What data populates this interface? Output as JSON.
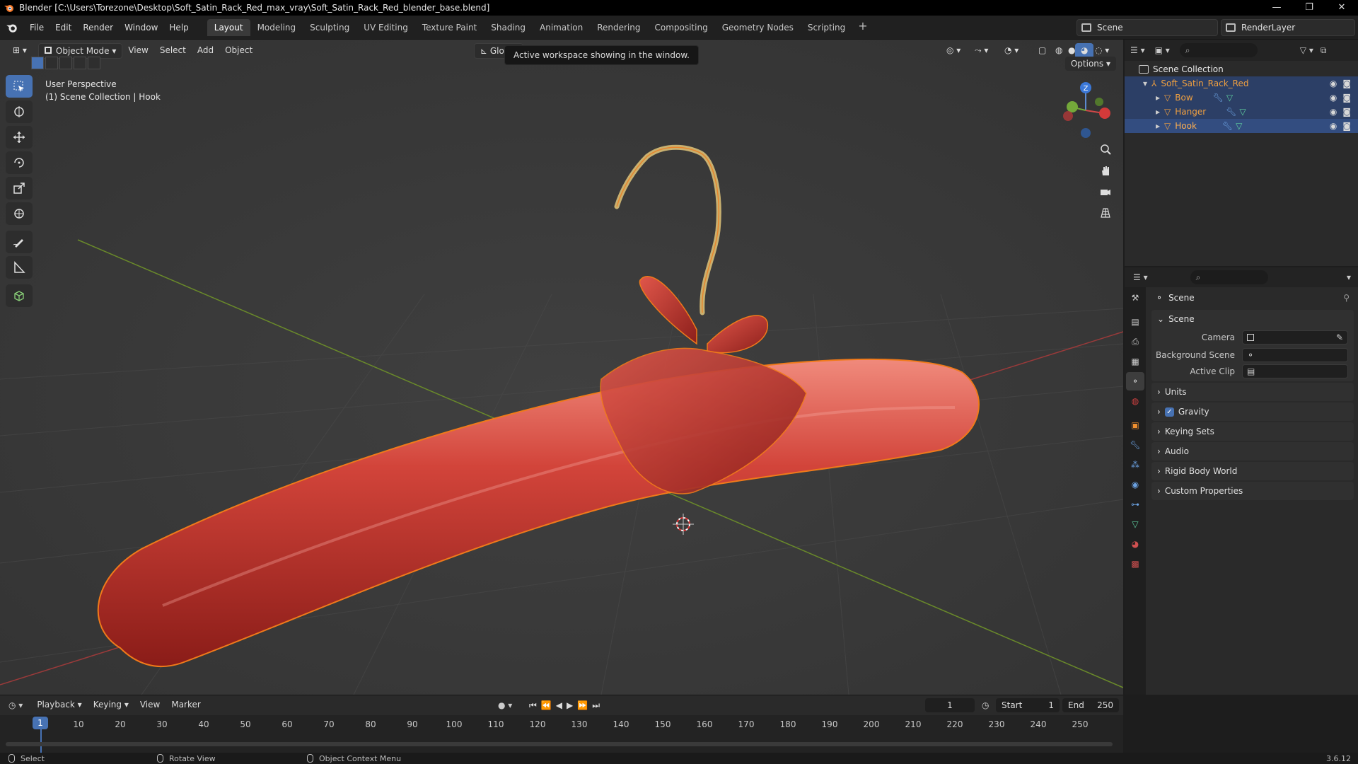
{
  "window": {
    "title": "Blender [C:\\Users\\Torezone\\Desktop\\Soft_Satin_Rack_Red_max_vray\\Soft_Satin_Rack_Red_blender_base.blend]",
    "controls": [
      "—",
      "❐",
      "✕"
    ]
  },
  "menubar": {
    "items": [
      "File",
      "Edit",
      "Render",
      "Window",
      "Help"
    ],
    "workspaces": [
      "Layout",
      "Modeling",
      "Sculpting",
      "UV Editing",
      "Texture Paint",
      "Shading",
      "Animation",
      "Rendering",
      "Compositing",
      "Geometry Nodes",
      "Scripting"
    ],
    "active_workspace": "Layout",
    "add_workspace": "+",
    "scene": "Scene",
    "view_layer": "RenderLayer"
  },
  "viewport": {
    "mode": "Object Mode",
    "menus": [
      "View",
      "Select",
      "Add",
      "Object"
    ],
    "orientation": "Global",
    "tooltip": "Active workspace showing in the window.",
    "options": "Options",
    "overlay_line1": "User Perspective",
    "overlay_line2": "(1) Scene Collection | Hook",
    "gizmo_z": "Z"
  },
  "outliner": {
    "root": "Scene Collection",
    "collection": "Soft_Satin_Rack_Red",
    "objects": [
      "Bow",
      "Hanger",
      "Hook"
    ]
  },
  "properties": {
    "context": "Scene",
    "panel": "Scene",
    "camera_label": "Camera",
    "background_label": "Background Scene",
    "clip_label": "Active Clip",
    "subpanels": [
      "Units",
      "Gravity",
      "Keying Sets",
      "Audio",
      "Rigid Body World",
      "Custom Properties"
    ],
    "gravity_checked": "✓"
  },
  "timeline": {
    "menus": [
      "Playback",
      "Keying",
      "View",
      "Marker"
    ],
    "current_frame": "1",
    "start_label": "Start",
    "start": "1",
    "end_label": "End",
    "end": "250",
    "ticks": [
      "10",
      "20",
      "30",
      "40",
      "50",
      "60",
      "70",
      "80",
      "90",
      "100",
      "110",
      "120",
      "130",
      "140",
      "150",
      "160",
      "170",
      "180",
      "190",
      "200",
      "210",
      "220",
      "230",
      "240",
      "250"
    ],
    "marker_frame": "1"
  },
  "statusbar": {
    "select": "Select",
    "rotate": "Rotate View",
    "context": "Object Context Menu",
    "version": "3.6.12"
  },
  "colors": {
    "accent": "#4772b3",
    "selection_outline": "#f07a1a",
    "object_label": "#f0a040",
    "satin_red": "#c8322e"
  }
}
